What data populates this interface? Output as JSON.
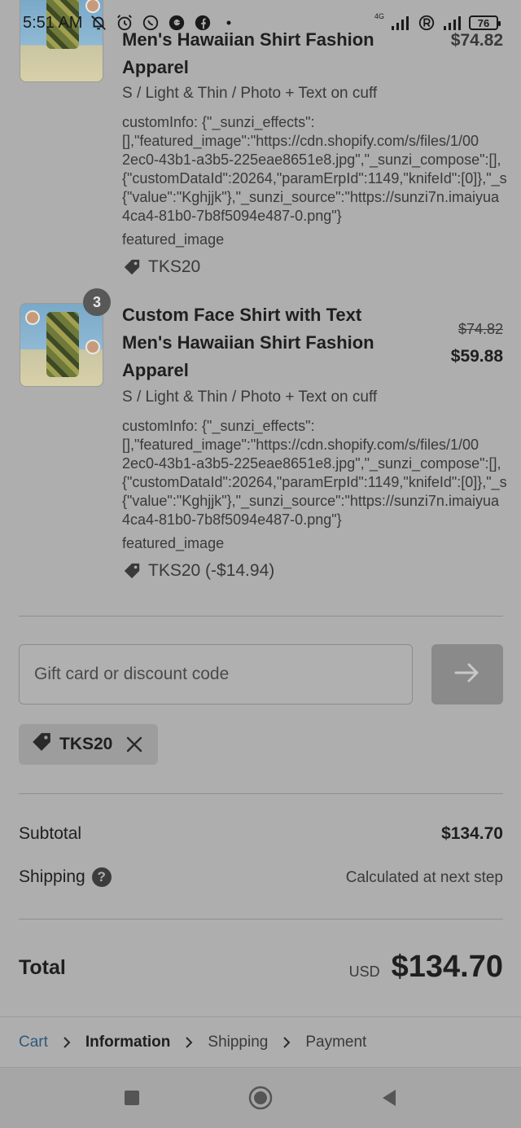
{
  "status_bar": {
    "time": "5:51 AM",
    "network": "4G",
    "battery": "76",
    "icons": [
      "bell-off-icon",
      "alarm-icon",
      "whatsapp-icon",
      "g-icon",
      "facebook-icon",
      "dot-icon",
      "signal-icon",
      "r-icon",
      "signal-icon",
      "battery-icon"
    ]
  },
  "items": [
    {
      "title_partial": "Men's Hawaiian Shirt Fashion",
      "title_line2": "Apparel",
      "price_partial": "$74.82",
      "variant": "S / Light & Thin / Photo + Text on cuff",
      "custom_info": "customInfo: {\"_sunzi_effects\":\n[],\"featured_image\":\"https://cdn.shopify.com/s/files/1/00\n2ec0-43b1-a3b5-225eae8651e8.jpg\",\"_sunzi_compose\":[],\n{\"customDataId\":20264,\"paramErpId\":1149,\"knifeId\":[0]},\"_s\n{\"value\":\"Kghjjk\"},\"_sunzi_source\":\"https://sunzi7n.imaiyua\n4ca4-81b0-7b8f5094e487-0.png\"}",
      "featured": "featured_image",
      "tag": "TKS20"
    },
    {
      "quantity": "3",
      "title": "Custom Face Shirt with Text Men's Hawaiian Shirt Fashion Apparel",
      "price_original": "$74.82",
      "price": "$59.88",
      "variant": "S / Light & Thin / Photo + Text on cuff",
      "custom_info": "customInfo: {\"_sunzi_effects\":\n[],\"featured_image\":\"https://cdn.shopify.com/s/files/1/00\n2ec0-43b1-a3b5-225eae8651e8.jpg\",\"_sunzi_compose\":[],\n{\"customDataId\":20264,\"paramErpId\":1149,\"knifeId\":[0]},\"_s\n{\"value\":\"Kghjjk\"},\"_sunzi_source\":\"https://sunzi7n.imaiyua\n4ca4-81b0-7b8f5094e487-0.png\"}",
      "featured": "featured_image",
      "tag": "TKS20 (-$14.94)"
    }
  ],
  "discount": {
    "placeholder": "Gift card or discount code",
    "applied_code": "TKS20"
  },
  "summary": {
    "subtotal_label": "Subtotal",
    "subtotal_value": "$134.70",
    "shipping_label": "Shipping",
    "shipping_value": "Calculated at next step",
    "total_label": "Total",
    "currency": "USD",
    "total_value": "$134.70"
  },
  "breadcrumb": {
    "cart": "Cart",
    "information": "Information",
    "shipping": "Shipping",
    "payment": "Payment"
  },
  "colors": {
    "overlay_bg": "#aeaeae",
    "link": "#2e5a78",
    "text": "#1f1f1f"
  }
}
